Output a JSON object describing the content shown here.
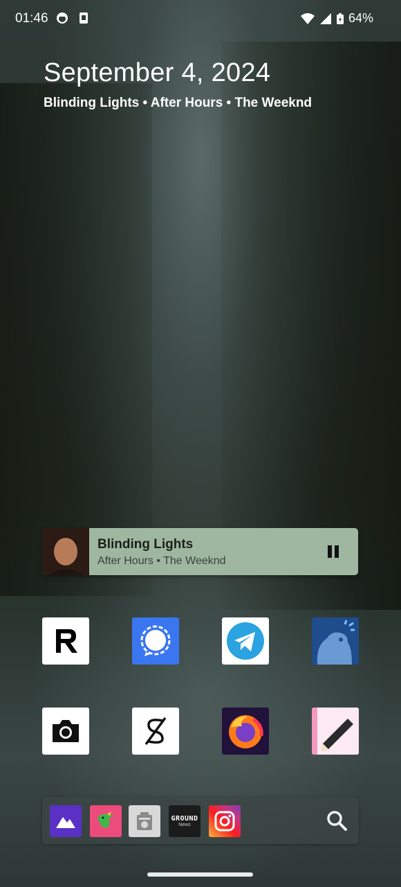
{
  "status": {
    "time": "01:46",
    "battery": "64%",
    "icons": [
      "ghost-icon",
      "sim-icon",
      "wifi-icon",
      "signal-icon",
      "battery-icon"
    ]
  },
  "date": "September 4, 2024",
  "now_playing_line": "Blinding Lights • After Hours • The Weeknd",
  "media": {
    "title": "Blinding Lights",
    "subtitle": "After Hours • The Weeknd",
    "state": "playing",
    "accent": "#9fb7a0"
  },
  "apps": [
    {
      "name": "revolut",
      "icon": "revolut-icon"
    },
    {
      "name": "signal",
      "icon": "signal-chat-icon"
    },
    {
      "name": "telegram",
      "icon": "telegram-icon"
    },
    {
      "name": "tusky",
      "icon": "mastodon-elephant-icon"
    },
    {
      "name": "camera",
      "icon": "camera-icon"
    },
    {
      "name": "s-app",
      "icon": "s-icon"
    },
    {
      "name": "firefox",
      "icon": "firefox-icon"
    },
    {
      "name": "notes",
      "icon": "notes-pen-icon"
    }
  ],
  "dock": {
    "apps": [
      {
        "name": "gallery",
        "icon": "mountain-icon"
      },
      {
        "name": "bird-app",
        "icon": "parrot-icon"
      },
      {
        "name": "radio-camera",
        "icon": "device-icon"
      },
      {
        "name": "ground-news",
        "label_top": "GROUND",
        "label_bottom": "News",
        "icon": "ground-news-icon"
      },
      {
        "name": "instagram",
        "icon": "instagram-icon"
      }
    ],
    "search_icon": "search-icon"
  }
}
